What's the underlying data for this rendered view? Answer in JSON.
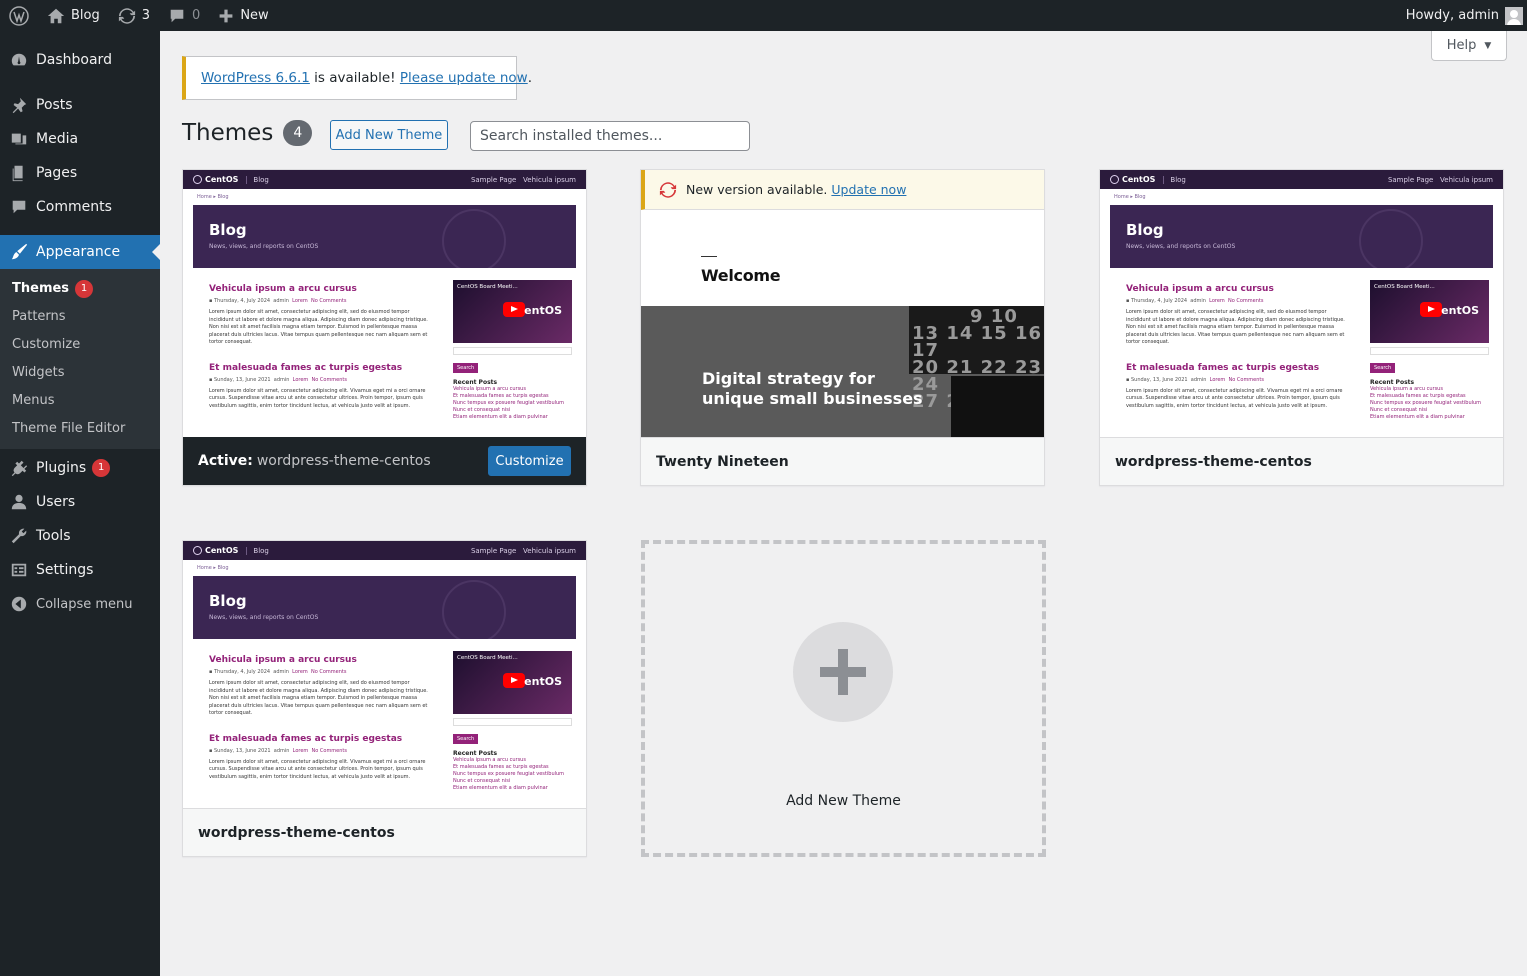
{
  "adminbar": {
    "site": "Blog",
    "updates": "3",
    "comments": "0",
    "new_label": "New",
    "howdy": "Howdy, admin"
  },
  "sidebar": {
    "items": [
      {
        "label": "Dashboard",
        "icon": "dashboard-icon"
      },
      {
        "label": "Posts",
        "icon": "pin-icon"
      },
      {
        "label": "Media",
        "icon": "media-icon"
      },
      {
        "label": "Pages",
        "icon": "pages-icon"
      },
      {
        "label": "Comments",
        "icon": "comments-icon"
      },
      {
        "label": "Appearance",
        "icon": "brush-icon"
      },
      {
        "label": "Plugins",
        "icon": "plug-icon",
        "badge": "1"
      },
      {
        "label": "Users",
        "icon": "users-icon"
      },
      {
        "label": "Tools",
        "icon": "wrench-icon"
      },
      {
        "label": "Settings",
        "icon": "settings-icon"
      },
      {
        "label": "Collapse menu",
        "icon": "collapse-icon"
      }
    ],
    "submenu": [
      {
        "label": "Themes",
        "badge": "1"
      },
      {
        "label": "Patterns"
      },
      {
        "label": "Customize"
      },
      {
        "label": "Widgets"
      },
      {
        "label": "Menus"
      },
      {
        "label": "Theme File Editor"
      }
    ]
  },
  "help": {
    "label": "Help"
  },
  "notice": {
    "version_link": "WordPress 6.6.1",
    "middle": " is available! ",
    "update_link": "Please update now",
    "end": "."
  },
  "page": {
    "title": "Themes",
    "count": "4",
    "add_button": "Add New Theme",
    "search_placeholder": "Search installed themes..."
  },
  "themes": [
    {
      "name": "wordpress-theme-centos",
      "active_label": "Active:",
      "customize_label": "Customize"
    },
    {
      "name": "Twenty Nineteen",
      "notice_text": "New version available.",
      "notice_link": "Update now",
      "preview_heading": "Welcome",
      "preview_tagline_1": "Digital strategy for",
      "preview_tagline_2": "unique small businesses",
      "cal_row_1": "9 10",
      "cal_row_2": "13 14 15 16 17",
      "cal_row_3": "20 21 22 23 24",
      "cal_row_4": "27 28"
    },
    {
      "name": "wordpress-theme-centos"
    },
    {
      "name": "wordpress-theme-centos"
    }
  ],
  "preview": {
    "logo": "CentOS",
    "blog": "Blog",
    "nav": "Sample Page   Vehicula ipsum",
    "crumb": "Home  ▸  Blog",
    "hero_title": "Blog",
    "hero_sub": "News, views, and reports on CentOS",
    "post1_title": "Vehicula ipsum a arcu cursus",
    "post1_meta_date": "▪ Thursday, 4, July 2024",
    "post1_meta_author": "admin",
    "post1_meta_cat": "Lorem",
    "post1_meta_comments": "No Comments",
    "post1_text": "Lorem ipsum dolor sit amet, consectetur adipiscing elit, sed do eiusmod tempor incididunt ut labore et dolore magna aliqua. Adipiscing diam donec adipiscing tristique. Non nisi est sit amet facilisis magna etiam tempor. Euismod in pellentesque massa placerat duis ultricies lacus. Vitae tempus quam pellentesque nec nam aliquam sem et tortor consequat.",
    "post2_title": "Et malesuada fames ac turpis egestas",
    "post2_meta_date": "▪ Sunday, 13, June 2021",
    "post2_meta_author": "admin",
    "post2_meta_cat": "Lorem",
    "post2_meta_comments": "No Comments",
    "post2_text": "Lorem ipsum dolor sit amet, consectetur adipiscing elit. Vivamus eget mi a orci ornare cursus. Suspendisse vitae arcu ut ante consectetur ultrices. Proin tempor, ipsum quis vestibulum sagittis, enim tortor tincidunt lectus, at vehicula justo velit at ipsum.",
    "video_title": "CentOS Board Meeti...",
    "video_brand": "entOS",
    "search_btn": "Search",
    "recent_posts": "Recent Posts",
    "recent_1": "Vehicula ipsum a arcu cursus",
    "recent_2": "Et malesuada fames ac turpis egestas",
    "recent_3": "Nunc tempus ex posuere feugiat vestibulum",
    "recent_4": "Nunc et consequat nisi",
    "recent_5": "Etiam elementum elit a diam pulvinar"
  },
  "add_theme_card": {
    "label": "Add New Theme"
  },
  "colors": {
    "admin_bg": "#1d2327",
    "accent": "#2271b1",
    "badge": "#d63638",
    "notice_warning": "#dba617"
  }
}
